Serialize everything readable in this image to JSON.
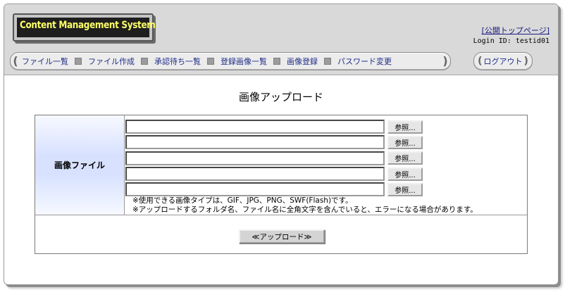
{
  "logo": {
    "text": "Content Management System"
  },
  "header": {
    "public_top_link": "[公開トップページ]",
    "login_id": "Login ID: testid01"
  },
  "nav": {
    "items": [
      {
        "label": "ファイル一覧"
      },
      {
        "label": "ファイル作成"
      },
      {
        "label": "承認待ち一覧"
      },
      {
        "label": "登録画像一覧"
      },
      {
        "label": "画像登録"
      },
      {
        "label": "パスワード変更"
      }
    ],
    "logout_label": "ログアウト"
  },
  "page_title": "画像アップロード",
  "form": {
    "label": "画像ファイル",
    "browse_label": "参照...",
    "file_values": [
      "",
      "",
      "",
      "",
      ""
    ],
    "notes": [
      "※使用できる画像タイプは、GIF、JPG、PNG、SWF(Flash)です。",
      "※アップロードするフォルダ名、ファイル名に全角文字を含んでいると、エラーになる場合があります。"
    ],
    "upload_label": "≪アップロード≫"
  },
  "colors": {
    "logo_text": "#ffff66",
    "nav_link": "#1f2d86",
    "label_cell": "#d8e2ff"
  },
  "icons": [
    "nav-left-cap-icon",
    "nav-right-cap-icon",
    "nav-separator-icon"
  ]
}
